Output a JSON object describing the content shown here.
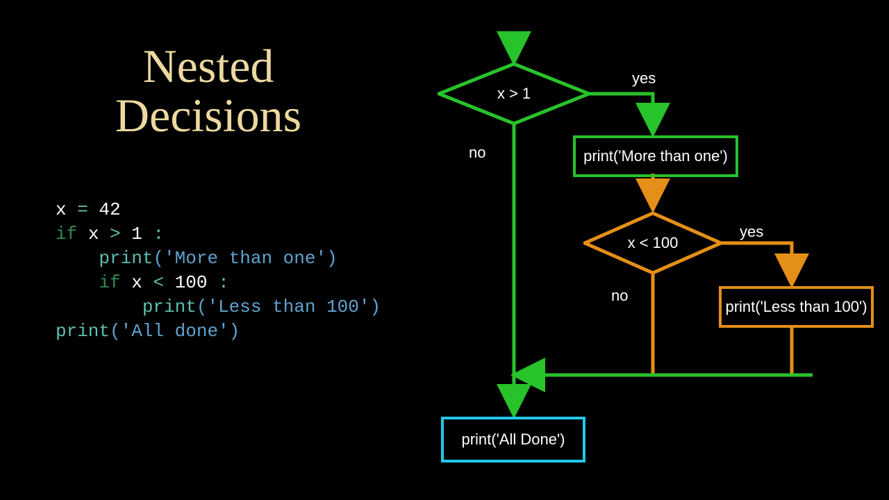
{
  "title_line1": "Nested",
  "title_line2": "Decisions",
  "code": {
    "l1_var": "x",
    "l1_eq": " = ",
    "l1_val": "42",
    "l2_kw": "if",
    "l2_cond_var": " x ",
    "l2_cond_op": ">",
    "l2_cond_num": " 1 ",
    "l2_colon": ":",
    "l3_fn": "    print",
    "l3_arg": "('More than one')",
    "l4_kw": "    if",
    "l4_cond_var": " x ",
    "l4_cond_op": "<",
    "l4_cond_num": " 100 ",
    "l4_colon": ":",
    "l5_fn": "        print",
    "l5_arg": "('Less than 100')",
    "l6_fn": "print",
    "l6_arg": "('All done')"
  },
  "flow": {
    "decision1": "x > 1",
    "decision2": "x < 100",
    "box_more": "print('More than one')",
    "box_less": "print('Less than 100')",
    "box_done": "print('All Done')",
    "yes": "yes",
    "no": "no"
  },
  "colors": {
    "green": "#28c22a",
    "orange": "#e48f18",
    "cyan": "#20c8e8",
    "title": "#ecd9a0"
  }
}
